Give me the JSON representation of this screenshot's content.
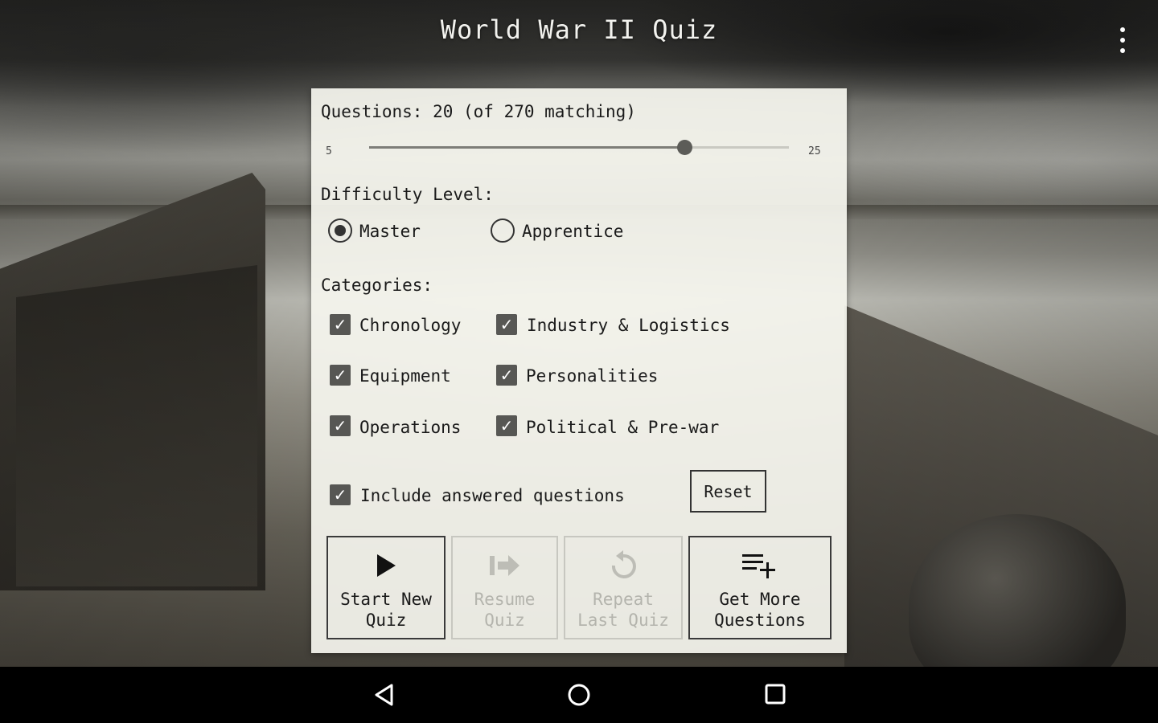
{
  "app": {
    "title": "World War II Quiz"
  },
  "questions": {
    "label": "Questions: 20 (of 270 matching)",
    "min_label": "5",
    "max_label": "25",
    "min": 5,
    "max": 25,
    "value": 20
  },
  "difficulty": {
    "heading": "Difficulty Level:",
    "options": [
      {
        "label": "Master",
        "selected": true
      },
      {
        "label": "Apprentice",
        "selected": false
      }
    ]
  },
  "categories": {
    "heading": "Categories:",
    "items": [
      {
        "label": "Chronology",
        "checked": true
      },
      {
        "label": "Industry & Logistics",
        "checked": true
      },
      {
        "label": "Equipment",
        "checked": true
      },
      {
        "label": "Personalities",
        "checked": true
      },
      {
        "label": "Operations",
        "checked": true
      },
      {
        "label": "Political & Pre-war",
        "checked": true
      }
    ]
  },
  "include_answered": {
    "label": "Include answered questions",
    "checked": true
  },
  "reset": {
    "label": "Reset"
  },
  "actions": [
    {
      "line1": "Start New",
      "line2": "Quiz",
      "icon": "play-icon",
      "enabled": true
    },
    {
      "line1": "Resume",
      "line2": "Quiz",
      "icon": "resume-arrow-icon",
      "enabled": false
    },
    {
      "line1": "Repeat",
      "line2": "Last Quiz",
      "icon": "repeat-icon",
      "enabled": false
    },
    {
      "line1": "Get More",
      "line2": "Questions",
      "icon": "playlist-add-icon",
      "enabled": true
    }
  ],
  "nav": {
    "back": "back-icon",
    "home": "home-icon",
    "recents": "recents-icon"
  }
}
